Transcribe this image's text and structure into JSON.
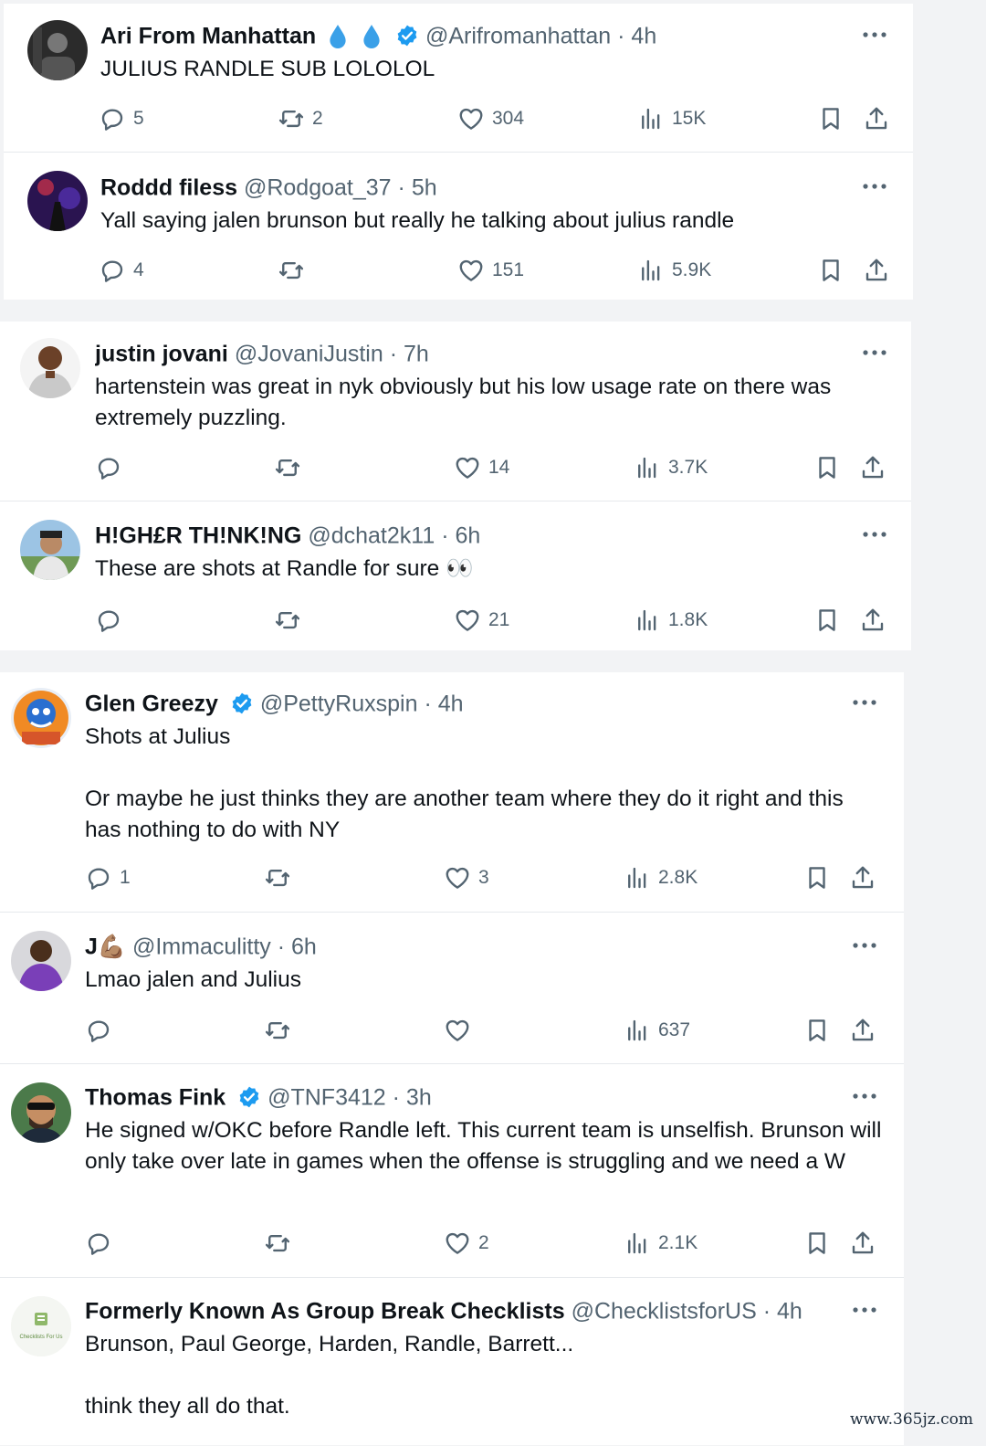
{
  "icons": {
    "reply": "reply-icon",
    "repost": "repost-icon",
    "like": "heart-icon",
    "views": "views-chart-icon",
    "bookmark": "bookmark-icon",
    "share": "share-icon",
    "more": "more-dots-icon",
    "verified": "verified-badge-icon"
  },
  "colors": {
    "verified_blue": "#1d9bf0",
    "text_primary": "#0f1419",
    "text_secondary": "#536471",
    "background": "#f2f3f5"
  },
  "tweets": [
    {
      "name": "Ari From Manhattan",
      "handle": "@Arifromanhattan",
      "separator": "·",
      "time": "4h",
      "text": "JULIUS RANDLE SUB LOLOLOL",
      "stats": {
        "replies": "5",
        "reposts": "2",
        "likes": "304",
        "views": "15K"
      }
    },
    {
      "name": "Roddd filess",
      "handle": "@Rodgoat_37",
      "separator": "·",
      "time": "5h",
      "text": "Yall saying jalen brunson but really he talking about julius randle",
      "stats": {
        "replies": "4",
        "reposts": "",
        "likes": "151",
        "views": "5.9K"
      }
    },
    {
      "name": "justin jovani",
      "handle": "@JovaniJustin",
      "separator": "·",
      "time": "7h",
      "text": "hartenstein was great in nyk obviously but his low usage rate on there was extremely puzzling.",
      "stats": {
        "replies": "",
        "reposts": "",
        "likes": "14",
        "views": "3.7K"
      }
    },
    {
      "name": "H!GH£R TH!NK!NG",
      "handle": "@dchat2k11",
      "separator": "·",
      "time": "6h",
      "text": "These are shots at Randle for sure 👀",
      "stats": {
        "replies": "",
        "reposts": "",
        "likes": "21",
        "views": "1.8K"
      }
    },
    {
      "name": "Glen Greezy",
      "handle": "@PettyRuxspin",
      "separator": "·",
      "time": "4h",
      "text": "Shots at Julius\n\nOr maybe he just thinks they are another team where they do it right and this has nothing to do with NY",
      "stats": {
        "replies": "1",
        "reposts": "",
        "likes": "3",
        "views": "2.8K"
      }
    },
    {
      "name": "J💪🏽",
      "handle": "@Immaculitty",
      "separator": "·",
      "time": "6h",
      "text": "Lmao jalen and Julius",
      "stats": {
        "replies": "",
        "reposts": "",
        "likes": "",
        "views": "637"
      }
    },
    {
      "name": "Thomas Fink",
      "handle": "@TNF3412",
      "separator": "·",
      "time": "3h",
      "text": "He signed w/OKC before Randle left. This current team is unselfish. Brunson will only take over late in games when the offense is struggling and we need a W",
      "stats": {
        "replies": "",
        "reposts": "",
        "likes": "2",
        "views": "2.1K"
      }
    },
    {
      "name": "Formerly Known As Group Break Checklists",
      "handle": "@ChecklistsforUS",
      "separator": "·",
      "time": "4h",
      "text": "Brunson, Paul George, Harden, Randle, Barrett...\n\nthink they all do that.",
      "avatar_text": "Checklists For Us",
      "stats": {}
    }
  ],
  "watermark": "www.365jz.com"
}
